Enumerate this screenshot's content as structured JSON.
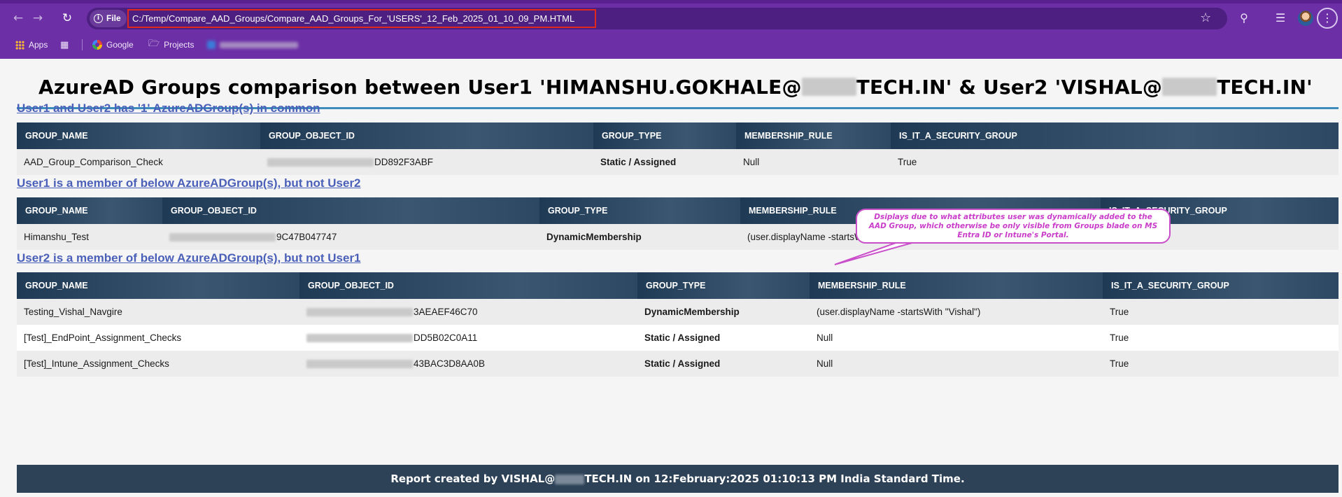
{
  "browser": {
    "site_chip": "File",
    "url": "C:/Temp/Compare_AAD_Groups/Compare_AAD_Groups_For_'USERS'_12_Feb_2025_01_10_09_PM.HTML",
    "bookmarks": {
      "apps": "Apps",
      "google": "Google",
      "projects": "Projects"
    },
    "icons": [
      "back-icon",
      "forward-icon",
      "reload-icon",
      "star-icon",
      "extensions-icon",
      "media-icon",
      "avatar",
      "menu-icon"
    ]
  },
  "report": {
    "title_prefix": "AzureAD Groups comparison between User1 'HIMANSHU.GOKHALE@",
    "title_middle": "TECH.IN' & User2 'VISHAL@",
    "title_suffix": "TECH.IN'",
    "columns": [
      "GROUP_NAME",
      "GROUP_OBJECT_ID",
      "GROUP_TYPE",
      "MEMBERSHIP_RULE",
      "IS_IT_A_SECURITY_GROUP"
    ],
    "sections": [
      {
        "heading": "User1 and User2 has '1' AzureADGroup(s) in common",
        "rows": [
          {
            "group_name": "AAD_Group_Comparison_Check",
            "object_id_visible": "DD892F3ABF",
            "group_type": "Static / Assigned",
            "membership_rule": "Null",
            "is_security_group": "True"
          }
        ]
      },
      {
        "heading": "User1 is a member of below AzureADGroup(s), but not User2",
        "rows": [
          {
            "group_name": "Himanshu_Test",
            "object_id_visible": "9C47B047747",
            "group_type": "DynamicMembership",
            "membership_rule": "(user.displayName -startsWith \"Himanshu\")",
            "is_security_group": "True"
          }
        ]
      },
      {
        "heading": "User2 is a member of below AzureADGroup(s), but not User1",
        "rows": [
          {
            "group_name": "Testing_Vishal_Navgire",
            "object_id_visible": "3AEAEF46C70",
            "group_type": "DynamicMembership",
            "membership_rule": "(user.displayName -startsWith \"Vishal\")",
            "is_security_group": "True"
          },
          {
            "group_name": "[Test]_EndPoint_Assignment_Checks",
            "object_id_visible": "DD5B02C0A11",
            "group_type": "Static / Assigned",
            "membership_rule": "Null",
            "is_security_group": "True"
          },
          {
            "group_name": "[Test]_Intune_Assignment_Checks",
            "object_id_visible": "43BAC3D8AA0B",
            "group_type": "Static / Assigned",
            "membership_rule": "Null",
            "is_security_group": "True"
          }
        ]
      }
    ],
    "callout": "Dsiplays due to what attributes user was dynamically added to the AAD Group, which otherwise be only visible from Groups blade on MS Entra ID or Intune's Portal.",
    "footer_prefix": "Report created by VISHAL@",
    "footer_suffix": "TECH.IN on 12:February:2025 01:10:13 PM India Standard Time."
  },
  "colors": {
    "chrome": "#6c2fa6",
    "header_bar": "#2e4a64",
    "static": "#1a9a4a",
    "dynamic": "#f0952a",
    "link": "#4a5fb8",
    "callout": "#c94ec9",
    "url_outline": "#e0281f"
  }
}
